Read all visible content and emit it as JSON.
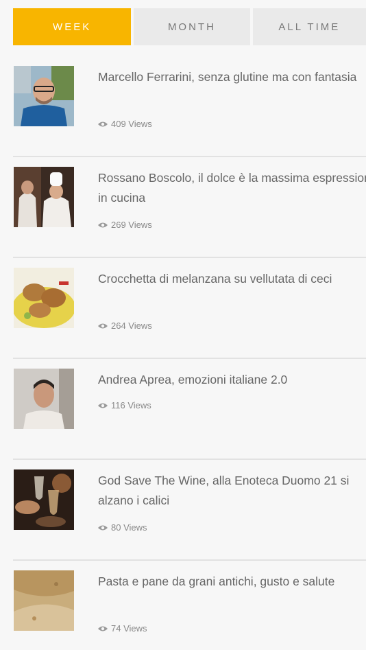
{
  "tabs": [
    {
      "label": "WEEK",
      "active": true
    },
    {
      "label": "MONTH",
      "active": false
    },
    {
      "label": "ALL TIME",
      "active": false
    }
  ],
  "colors": {
    "accent": "#f8b500",
    "tab_bg": "#eaeaea",
    "divider": "#e2e2e2"
  },
  "posts": [
    {
      "title": "Marcello Ferrarini, senza glutine ma con fantasia",
      "views": "409 Views",
      "thumb": "chef-portrait"
    },
    {
      "title": "Rossano Boscolo, il dolce è la massima espressione in cucina",
      "views": "269 Views",
      "thumb": "chefs-kitchen"
    },
    {
      "title": "Crocchetta di melanzana su vellutata di ceci",
      "views": "264 Views",
      "thumb": "croquette-dish"
    },
    {
      "title": "Andrea Aprea, emozioni italiane 2.0",
      "views": "116 Views",
      "thumb": "chef-headshot"
    },
    {
      "title": "God Save The Wine, alla Enoteca Duomo 21 si alzano i calici",
      "views": "80 Views",
      "thumb": "wine-glasses"
    },
    {
      "title": "Pasta e pane da grani antichi, gusto e salute",
      "views": "74 Views",
      "thumb": "flour"
    }
  ]
}
